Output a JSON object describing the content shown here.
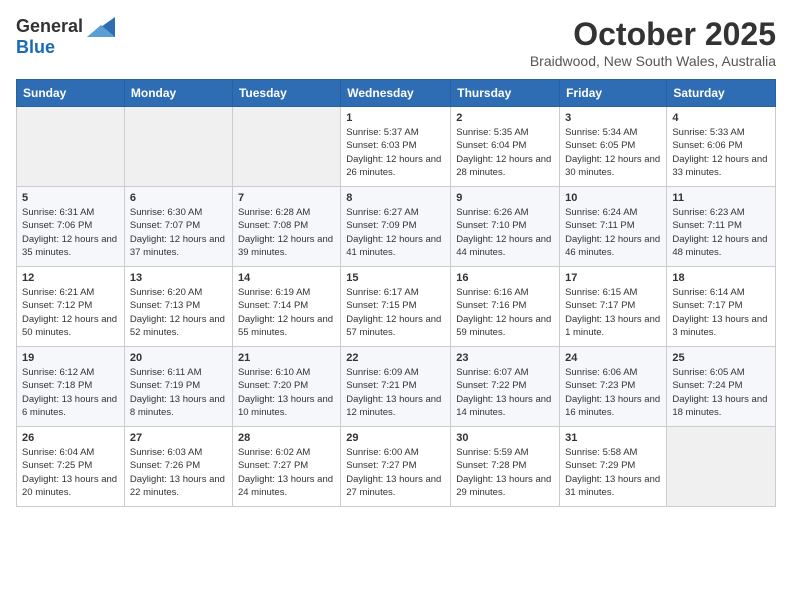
{
  "logo": {
    "general": "General",
    "blue": "Blue"
  },
  "title": "October 2025",
  "location": "Braidwood, New South Wales, Australia",
  "days_of_week": [
    "Sunday",
    "Monday",
    "Tuesday",
    "Wednesday",
    "Thursday",
    "Friday",
    "Saturday"
  ],
  "weeks": [
    [
      {
        "day": "",
        "sunrise": "",
        "sunset": "",
        "daylight": ""
      },
      {
        "day": "",
        "sunrise": "",
        "sunset": "",
        "daylight": ""
      },
      {
        "day": "",
        "sunrise": "",
        "sunset": "",
        "daylight": ""
      },
      {
        "day": "1",
        "sunrise": "5:37 AM",
        "sunset": "6:03 PM",
        "daylight": "12 hours and 26 minutes."
      },
      {
        "day": "2",
        "sunrise": "5:35 AM",
        "sunset": "6:04 PM",
        "daylight": "12 hours and 28 minutes."
      },
      {
        "day": "3",
        "sunrise": "5:34 AM",
        "sunset": "6:05 PM",
        "daylight": "12 hours and 30 minutes."
      },
      {
        "day": "4",
        "sunrise": "5:33 AM",
        "sunset": "6:06 PM",
        "daylight": "12 hours and 33 minutes."
      }
    ],
    [
      {
        "day": "5",
        "sunrise": "6:31 AM",
        "sunset": "7:06 PM",
        "daylight": "12 hours and 35 minutes."
      },
      {
        "day": "6",
        "sunrise": "6:30 AM",
        "sunset": "7:07 PM",
        "daylight": "12 hours and 37 minutes."
      },
      {
        "day": "7",
        "sunrise": "6:28 AM",
        "sunset": "7:08 PM",
        "daylight": "12 hours and 39 minutes."
      },
      {
        "day": "8",
        "sunrise": "6:27 AM",
        "sunset": "7:09 PM",
        "daylight": "12 hours and 41 minutes."
      },
      {
        "day": "9",
        "sunrise": "6:26 AM",
        "sunset": "7:10 PM",
        "daylight": "12 hours and 44 minutes."
      },
      {
        "day": "10",
        "sunrise": "6:24 AM",
        "sunset": "7:11 PM",
        "daylight": "12 hours and 46 minutes."
      },
      {
        "day": "11",
        "sunrise": "6:23 AM",
        "sunset": "7:11 PM",
        "daylight": "12 hours and 48 minutes."
      }
    ],
    [
      {
        "day": "12",
        "sunrise": "6:21 AM",
        "sunset": "7:12 PM",
        "daylight": "12 hours and 50 minutes."
      },
      {
        "day": "13",
        "sunrise": "6:20 AM",
        "sunset": "7:13 PM",
        "daylight": "12 hours and 52 minutes."
      },
      {
        "day": "14",
        "sunrise": "6:19 AM",
        "sunset": "7:14 PM",
        "daylight": "12 hours and 55 minutes."
      },
      {
        "day": "15",
        "sunrise": "6:17 AM",
        "sunset": "7:15 PM",
        "daylight": "12 hours and 57 minutes."
      },
      {
        "day": "16",
        "sunrise": "6:16 AM",
        "sunset": "7:16 PM",
        "daylight": "12 hours and 59 minutes."
      },
      {
        "day": "17",
        "sunrise": "6:15 AM",
        "sunset": "7:17 PM",
        "daylight": "13 hours and 1 minute."
      },
      {
        "day": "18",
        "sunrise": "6:14 AM",
        "sunset": "7:17 PM",
        "daylight": "13 hours and 3 minutes."
      }
    ],
    [
      {
        "day": "19",
        "sunrise": "6:12 AM",
        "sunset": "7:18 PM",
        "daylight": "13 hours and 6 minutes."
      },
      {
        "day": "20",
        "sunrise": "6:11 AM",
        "sunset": "7:19 PM",
        "daylight": "13 hours and 8 minutes."
      },
      {
        "day": "21",
        "sunrise": "6:10 AM",
        "sunset": "7:20 PM",
        "daylight": "13 hours and 10 minutes."
      },
      {
        "day": "22",
        "sunrise": "6:09 AM",
        "sunset": "7:21 PM",
        "daylight": "13 hours and 12 minutes."
      },
      {
        "day": "23",
        "sunrise": "6:07 AM",
        "sunset": "7:22 PM",
        "daylight": "13 hours and 14 minutes."
      },
      {
        "day": "24",
        "sunrise": "6:06 AM",
        "sunset": "7:23 PM",
        "daylight": "13 hours and 16 minutes."
      },
      {
        "day": "25",
        "sunrise": "6:05 AM",
        "sunset": "7:24 PM",
        "daylight": "13 hours and 18 minutes."
      }
    ],
    [
      {
        "day": "26",
        "sunrise": "6:04 AM",
        "sunset": "7:25 PM",
        "daylight": "13 hours and 20 minutes."
      },
      {
        "day": "27",
        "sunrise": "6:03 AM",
        "sunset": "7:26 PM",
        "daylight": "13 hours and 22 minutes."
      },
      {
        "day": "28",
        "sunrise": "6:02 AM",
        "sunset": "7:27 PM",
        "daylight": "13 hours and 24 minutes."
      },
      {
        "day": "29",
        "sunrise": "6:00 AM",
        "sunset": "7:27 PM",
        "daylight": "13 hours and 27 minutes."
      },
      {
        "day": "30",
        "sunrise": "5:59 AM",
        "sunset": "7:28 PM",
        "daylight": "13 hours and 29 minutes."
      },
      {
        "day": "31",
        "sunrise": "5:58 AM",
        "sunset": "7:29 PM",
        "daylight": "13 hours and 31 minutes."
      },
      {
        "day": "",
        "sunrise": "",
        "sunset": "",
        "daylight": ""
      }
    ]
  ]
}
